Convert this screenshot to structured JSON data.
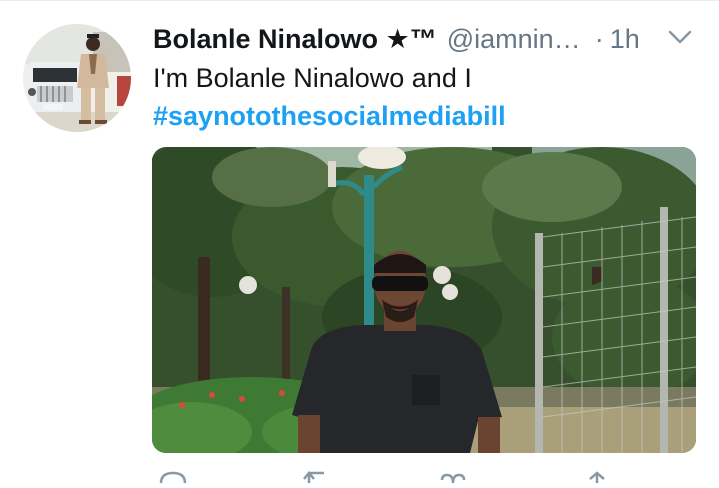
{
  "tweet": {
    "display_name": "Bolanle Ninalowo ★™",
    "handle": "@iamnin…",
    "separator": "·",
    "time": "1h",
    "text_line": "I'm Bolanle Ninalowo and I",
    "hashtag": "#saynotothesocialmediabill"
  },
  "icons": {
    "caret": "chevron-down-icon",
    "reply": "reply-icon",
    "retweet": "retweet-icon",
    "like": "heart-icon",
    "share": "share-icon"
  },
  "colors": {
    "hashtag": "#1da1f2",
    "secondary_text": "#657786",
    "primary_text": "#14171a",
    "border": "#e6ecf0"
  }
}
